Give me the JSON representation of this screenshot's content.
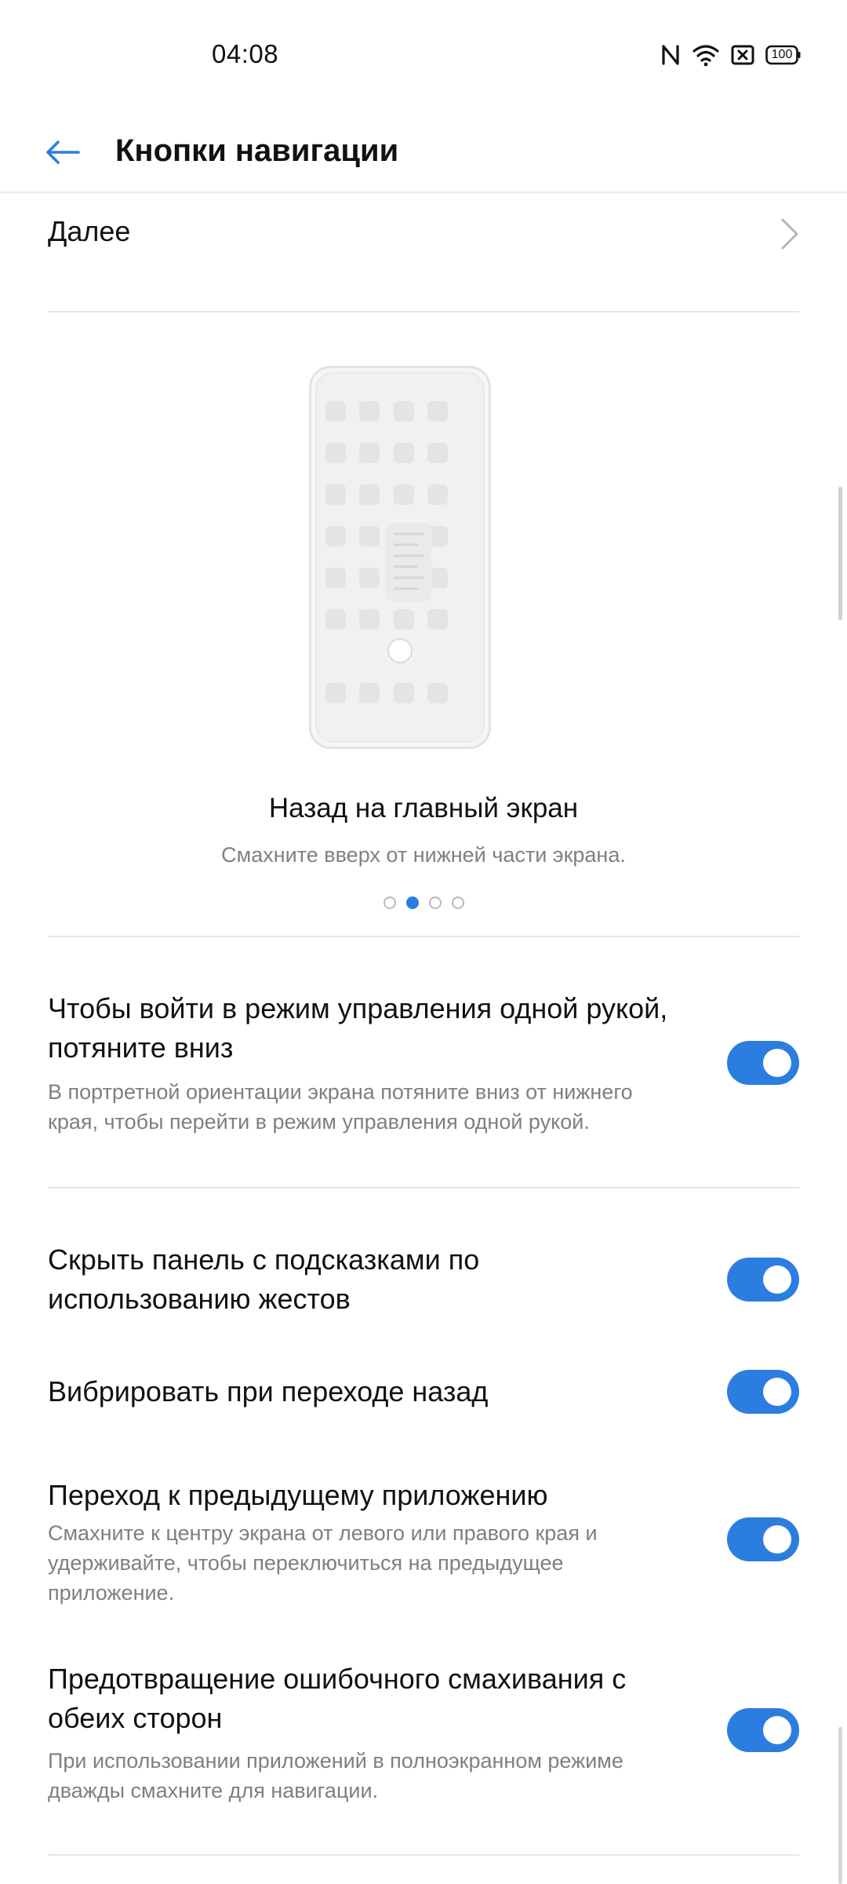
{
  "status_bar": {
    "time": "04:08",
    "battery": "100",
    "icons": [
      "nfc-icon",
      "wifi-icon",
      "sim-off-icon",
      "battery-icon"
    ]
  },
  "header": {
    "back_icon": "arrow-left-icon",
    "title": "Кнопки навигации"
  },
  "next_row": {
    "label": "Далее",
    "icon": "chevron-right-icon"
  },
  "gesture_demo": {
    "title": "Назад на главный экран",
    "subtitle": "Смахните вверх от нижней части экрана.",
    "page_count": 4,
    "active_page": 2
  },
  "settings": [
    {
      "title": "Чтобы войти в режим управления одной рукой, потяните вниз",
      "description": "В портретной ориентации экрана потяните вниз от нижнего края, чтобы перейти в режим управления одной рукой.",
      "enabled": true
    },
    {
      "title": "Скрыть панель с подсказками по использованию жестов",
      "description": "",
      "enabled": true
    },
    {
      "title": "Вибрировать при переходе назад",
      "description": "",
      "enabled": true
    },
    {
      "title": "Переход к предыдущему приложению",
      "description": "Смахните к центру экрана от левого или правого края и удерживайте, чтобы переключиться на предыдущее приложение.",
      "enabled": true
    },
    {
      "title": "Предотвращение ошибочного смахивания с обеих сторон",
      "description": "При использовании приложений в полноэкранном режиме дважды смахните для навигации.",
      "enabled": true
    }
  ],
  "colors": {
    "accent": "#2c7de0",
    "text_primary": "#111111",
    "text_secondary": "#7f7f7f",
    "divider": "#e6e6e6"
  }
}
